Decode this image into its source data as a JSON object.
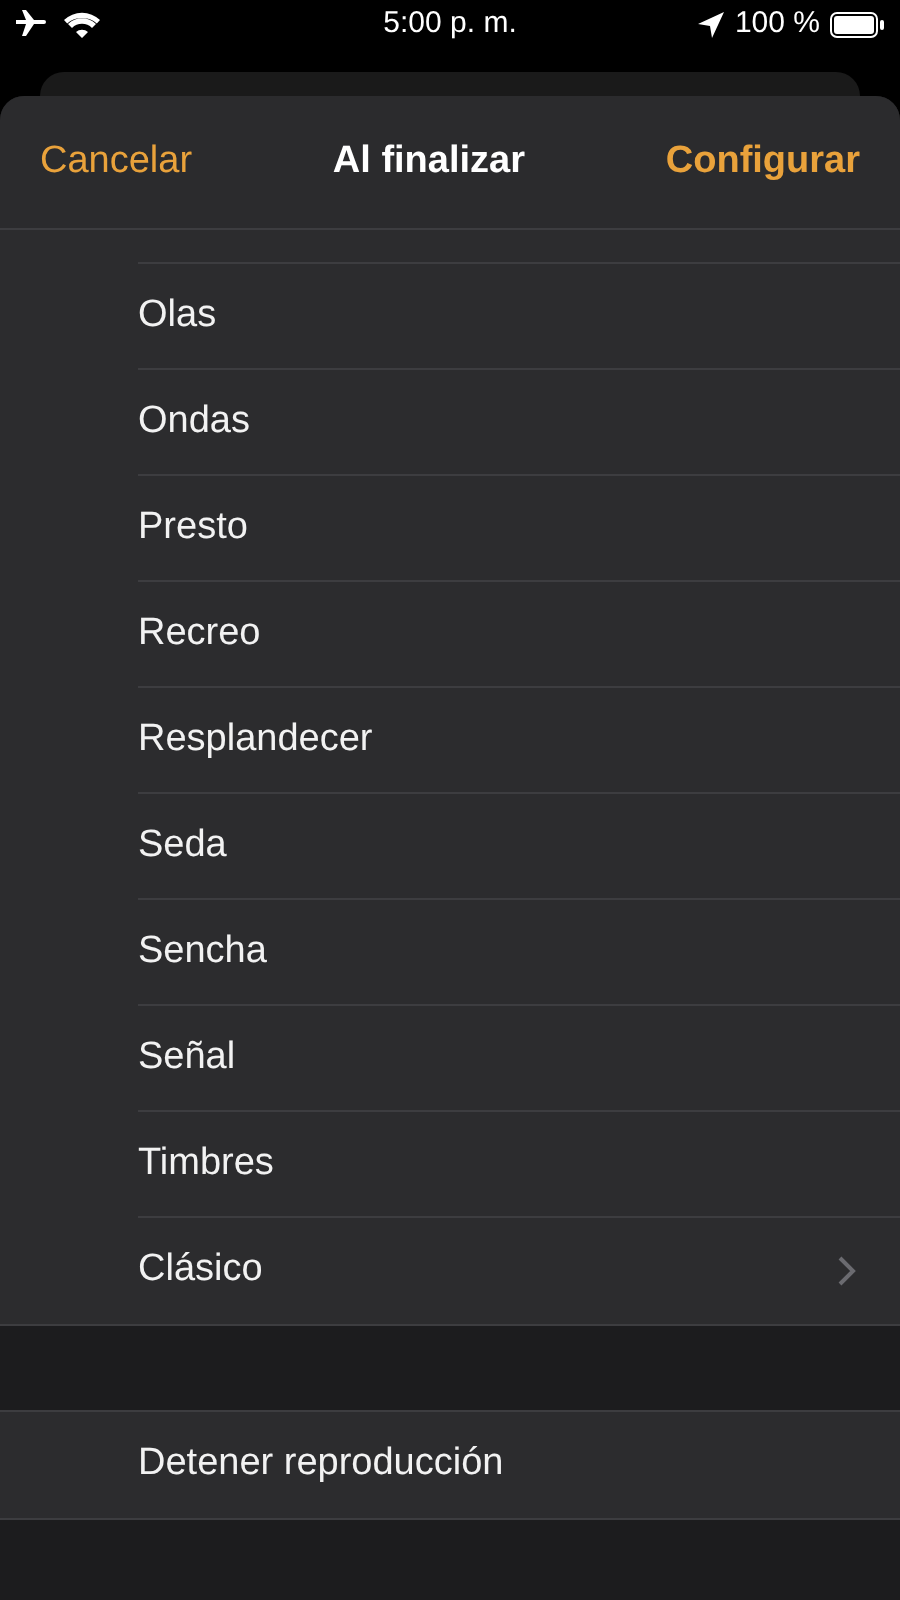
{
  "status_bar": {
    "time": "5:00 p. m.",
    "battery": "100 %"
  },
  "header": {
    "cancel": "Cancelar",
    "title": "Al finalizar",
    "confirm": "Configurar"
  },
  "tones": [
    {
      "label": "Olas",
      "kind": "tone"
    },
    {
      "label": "Ondas",
      "kind": "tone"
    },
    {
      "label": "Presto",
      "kind": "tone"
    },
    {
      "label": "Recreo",
      "kind": "tone"
    },
    {
      "label": "Resplandecer",
      "kind": "tone"
    },
    {
      "label": "Seda",
      "kind": "tone"
    },
    {
      "label": "Sencha",
      "kind": "tone"
    },
    {
      "label": "Señal",
      "kind": "tone"
    },
    {
      "label": "Timbres",
      "kind": "tone"
    },
    {
      "label": "Clásico",
      "kind": "submenu"
    }
  ],
  "actions": [
    {
      "label": "Detener reproducción"
    }
  ]
}
